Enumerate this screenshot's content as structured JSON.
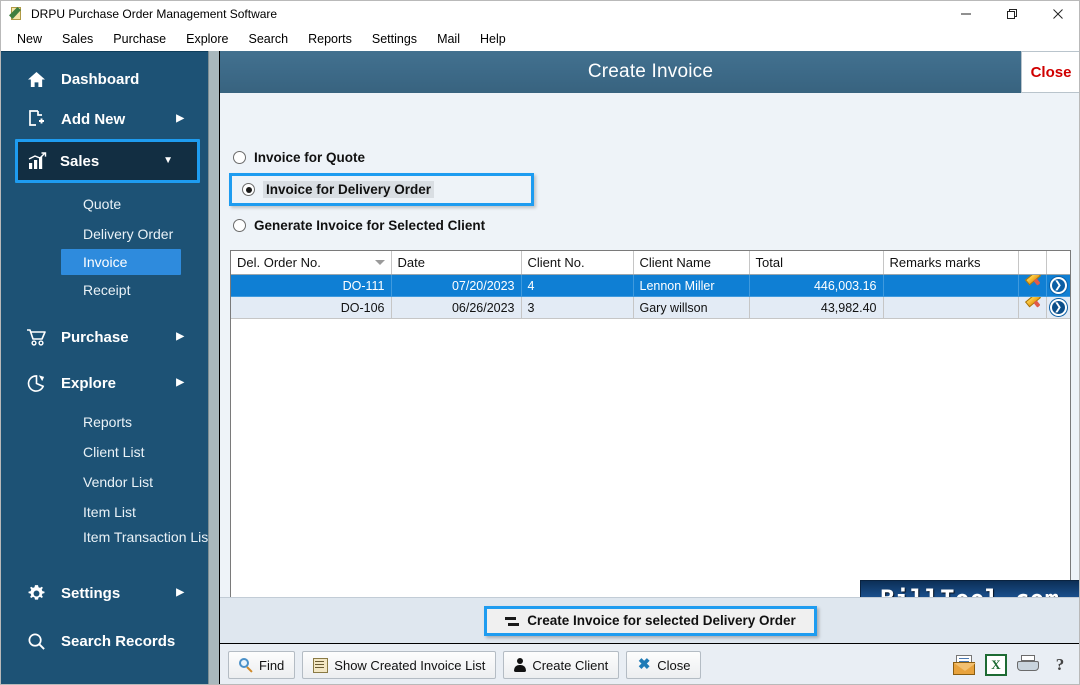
{
  "window": {
    "title": "DRPU Purchase Order Management Software",
    "icon": "app-icon",
    "buttons": {
      "minimize": "—",
      "maximize": "❐",
      "close": "✕"
    }
  },
  "menubar": {
    "items": [
      "New",
      "Sales",
      "Purchase",
      "Explore",
      "Search",
      "Reports",
      "Settings",
      "Mail",
      "Help"
    ]
  },
  "sidebar": {
    "items": [
      {
        "label": "Dashboard",
        "icon": "home-icon",
        "arrow": "",
        "type": "top"
      },
      {
        "label": "Add New",
        "icon": "add-document-icon",
        "arrow": "▶",
        "type": "top"
      },
      {
        "label": "Sales",
        "icon": "bar-chart-icon",
        "arrow": "▼",
        "type": "top",
        "selected": true
      },
      {
        "label": "Quote",
        "type": "sub"
      },
      {
        "label": "Delivery Order",
        "type": "sub"
      },
      {
        "label": "Invoice",
        "type": "sub",
        "active": true
      },
      {
        "label": "Receipt",
        "type": "sub"
      },
      {
        "label": "Purchase",
        "icon": "cart-icon",
        "arrow": "▶",
        "type": "top"
      },
      {
        "label": "Explore",
        "icon": "pie-chart-icon",
        "arrow": "▶",
        "type": "top"
      },
      {
        "label": "Reports",
        "type": "sub"
      },
      {
        "label": "Client List",
        "type": "sub"
      },
      {
        "label": "Vendor List",
        "type": "sub"
      },
      {
        "label": "Item List",
        "type": "sub"
      },
      {
        "label": "Item Transaction List",
        "type": "sub"
      },
      {
        "label": "Settings",
        "icon": "gear-icon",
        "arrow": "▶",
        "type": "top"
      },
      {
        "label": "Search Records",
        "icon": "search-icon",
        "arrow": "",
        "type": "top"
      }
    ]
  },
  "content": {
    "title": "Create Invoice",
    "close_label": "Close",
    "options": [
      {
        "label": "Invoice for Quote",
        "selected": false
      },
      {
        "label": "Invoice for Delivery Order",
        "selected": true
      },
      {
        "label": "Generate Invoice for Selected Client",
        "selected": false
      }
    ],
    "table": {
      "columns": [
        "Del. Order No.",
        "Date",
        "Client No.",
        "Client Name",
        "Total",
        "Remarks marks",
        "",
        ""
      ],
      "sorted_column": "Del. Order No.",
      "rows": [
        {
          "del_order_no": "DO-111",
          "date": "07/20/2023",
          "client_no": "4",
          "client_name": "Lennon Miller",
          "total": "446,003.16",
          "remarks": "",
          "selected": true
        },
        {
          "del_order_no": "DO-106",
          "date": "06/26/2023",
          "client_no": "3",
          "client_name": "Gary willson",
          "total": "43,982.40",
          "remarks": "",
          "selected": false
        }
      ]
    },
    "watermark": "BillTool.com",
    "primary_action": "Create Invoice for selected Delivery Order"
  },
  "toolbar": {
    "find": "Find",
    "show_created_invoice_list": "Show Created Invoice List",
    "create_client": "Create Client",
    "close": "Close",
    "excel_glyph": "X",
    "help_glyph": "?"
  },
  "colors": {
    "sidebar_bg": "#1d5275",
    "sidebar_selected_bg": "#122e42",
    "accent_blue": "#1e9cf0",
    "sub_active_bg": "#2e8bdd",
    "header_bg": "#3d6a88",
    "row_selected": "#0f7fd4",
    "row_alt": "#e3ebf5",
    "close_red": "#d00000"
  }
}
